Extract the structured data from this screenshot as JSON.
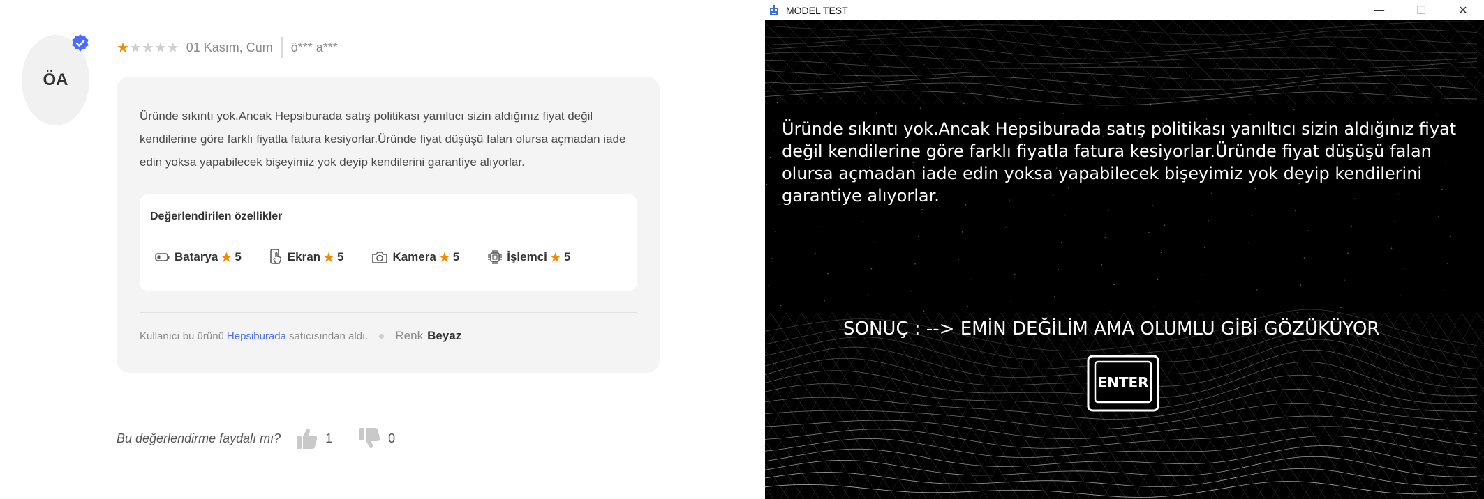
{
  "review": {
    "avatar_initials": "ÖA",
    "rating": 1,
    "rating_max": 5,
    "date": "01 Kasım, Cum",
    "username": "ö*** a***",
    "comment": "Üründe sıkıntı yok.Ancak Hepsiburada satış politikası yanıltıcı sizin aldığınız fiyat değil kendilerine göre farklı fiyatla fatura kesiyorlar.Üründe fiyat düşüşü falan olursa açmadan iade edin yoksa yapabilecek bişeyimiz yok deyip kendilerini garantiye alıyorlar.",
    "features_title": "Değerlendirilen özellikler",
    "features": [
      {
        "name": "Batarya",
        "value": "5",
        "icon": "battery-icon"
      },
      {
        "name": "Ekran",
        "value": "5",
        "icon": "screen-touch-icon"
      },
      {
        "name": "Kamera",
        "value": "5",
        "icon": "camera-icon"
      },
      {
        "name": "İşlemci",
        "value": "5",
        "icon": "processor-icon"
      }
    ],
    "seller_prefix": "Kullanıcı bu ürünü",
    "seller_name": "Hepsiburada",
    "seller_suffix": "satıcısından aldı.",
    "variant_label": "Renk",
    "variant_value": "Beyaz",
    "helpful_question": "Bu değerlendirme faydalı mı?",
    "likes": "1",
    "dislikes": "0",
    "colors": {
      "star": "#f28b00",
      "link": "#4a6cf7",
      "verified": "#4a6cf7"
    }
  },
  "window": {
    "title": "MODEL TEST",
    "minimize": "—",
    "maximize": "☐",
    "close": "✕",
    "input_text": "Üründe sıkıntı yok.Ancak Hepsiburada satış politikası yanıltıcı sizin aldığınız fiyat değil kendilerine göre farklı fiyatla fatura kesiyorlar.Üründe fiyat düşüşü falan olursa açmadan iade edin yoksa yapabilecek bişeyimiz yok deyip kendilerini garantiye alıyorlar.",
    "result_text": "SONUÇ :  --> EMİN DEĞİLİM AMA OLUMLU GİBİ GÖZÜKÜYOR",
    "enter_label": "ENTER"
  }
}
